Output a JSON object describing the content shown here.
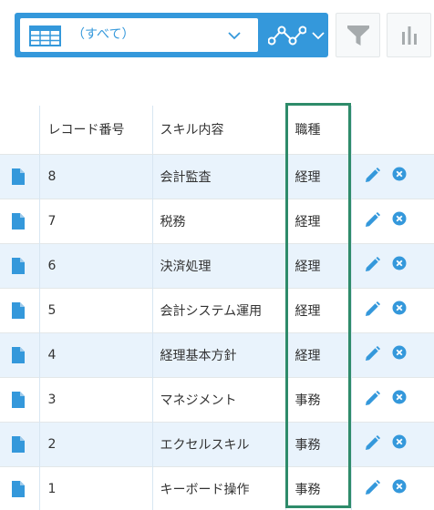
{
  "toolbar": {
    "view_label": "（すべて）",
    "view_icon": "table-icon",
    "graph_icon": "line-graph-icon",
    "filter_icon": "funnel-icon",
    "chart_icon": "bar-chart-icon",
    "accent_color": "#3498db"
  },
  "table": {
    "headers": {
      "record_number": "レコード番号",
      "skill": "スキル内容",
      "job": "職種"
    },
    "rows": [
      {
        "record_number": "8",
        "skill": "会計監査",
        "job": "経理"
      },
      {
        "record_number": "7",
        "skill": "税務",
        "job": "経理"
      },
      {
        "record_number": "6",
        "skill": "決済処理",
        "job": "経理"
      },
      {
        "record_number": "5",
        "skill": "会計システム運用",
        "job": "経理"
      },
      {
        "record_number": "4",
        "skill": "経理基本方針",
        "job": "経理"
      },
      {
        "record_number": "3",
        "skill": "マネジメント",
        "job": "事務"
      },
      {
        "record_number": "2",
        "skill": "エクセルスキル",
        "job": "事務"
      },
      {
        "record_number": "1",
        "skill": "キーボード操作",
        "job": "事務"
      }
    ],
    "row_icons": {
      "detail": "document-icon",
      "edit": "pencil-icon",
      "delete": "delete-circle-icon"
    }
  },
  "highlight_color": "#2e8b6a"
}
